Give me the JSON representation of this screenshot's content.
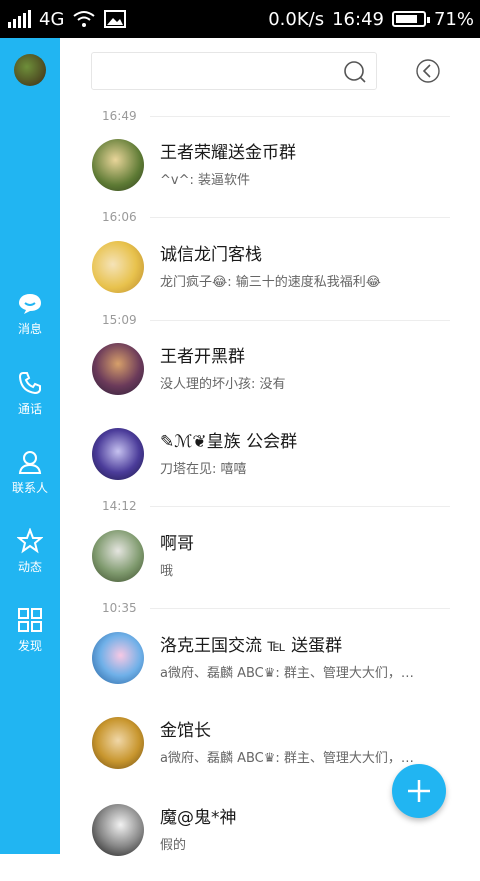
{
  "status_bar": {
    "network": "4G",
    "speed": "0.0K/s",
    "time": "16:49",
    "battery": "71%"
  },
  "sidebar": {
    "items": [
      {
        "label": "消息",
        "icon": "chat-bubble-icon"
      },
      {
        "label": "通话",
        "icon": "phone-icon"
      },
      {
        "label": "联系人",
        "icon": "contacts-icon"
      },
      {
        "label": "动态",
        "icon": "star-icon"
      },
      {
        "label": "发现",
        "icon": "grid-icon"
      }
    ],
    "accent": "#21b5f2"
  },
  "search": {
    "placeholder": ""
  },
  "conversations": [
    {
      "time": "16:49",
      "title": "王者荣耀送金币群",
      "preview": "^v^: 装逼软件"
    },
    {
      "time": "16:06",
      "title": "诚信龙门客栈",
      "preview": "龙门疯子😂: 输三十的速度私我福利😂"
    },
    {
      "time": "15:09",
      "title": "王者开黑群",
      "preview": "没人理的坏小孩: 没有"
    },
    {
      "time": "",
      "title": "✎ℳ❦皇族  公会群",
      "preview": "刀塔在见: 嘻嘻"
    },
    {
      "time": "14:12",
      "title": "啊哥",
      "preview": "哦"
    },
    {
      "time": "10:35",
      "title": "洛克王国交流 ℡ 送蛋群",
      "preview": "a微府、磊麟 ABC♛: 群主、管理大大们，…"
    },
    {
      "time": "",
      "title": "金馆长",
      "preview": "a微府、磊麟 ABC♛: 群主、管理大大们，…"
    },
    {
      "time": "",
      "title": "魔@鬼*神",
      "preview": "假的"
    }
  ],
  "fab": {
    "icon": "plus-icon"
  }
}
